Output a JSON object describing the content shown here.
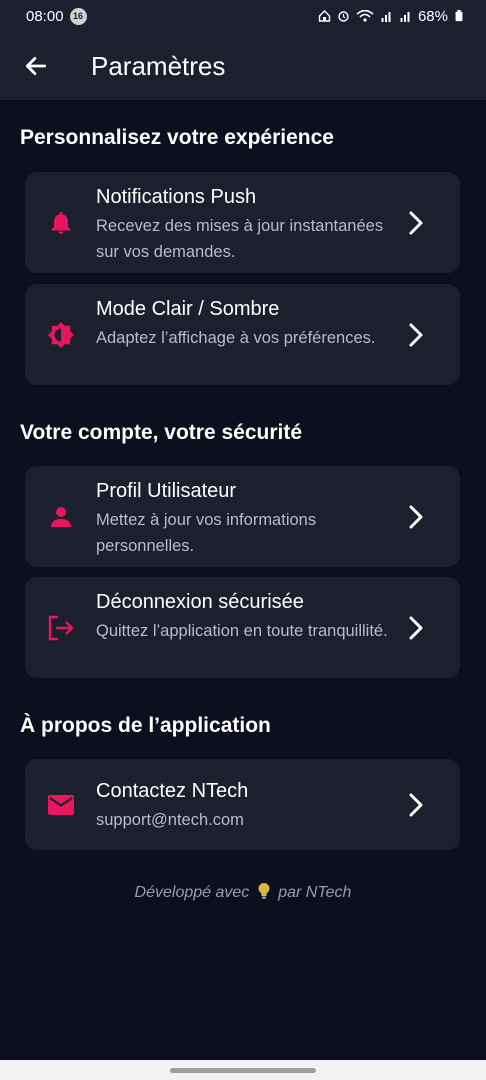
{
  "status_bar": {
    "time": "08:00",
    "notification_count": "16",
    "battery": "68%"
  },
  "app_bar": {
    "title": "Paramètres",
    "back_icon": "arrow-back-icon"
  },
  "sections": [
    {
      "title": "Personnalisez votre expérience",
      "items": [
        {
          "title": "Notifications Push",
          "subtitle": "Recevez des mises à jour instantanées sur vos demandes.",
          "icon": "bell-icon"
        },
        {
          "title": "Mode Clair / Sombre",
          "subtitle": "Adaptez l’affichage à vos préférences.",
          "icon": "brightness-icon"
        }
      ]
    },
    {
      "title": "Votre compte, votre sécurité",
      "items": [
        {
          "title": "Profil Utilisateur",
          "subtitle": "Mettez à jour vos informations personnelles.",
          "icon": "person-icon"
        },
        {
          "title": "Déconnexion sécurisée",
          "subtitle": "Quittez l’application en toute tranquillité.",
          "icon": "logout-icon"
        }
      ]
    },
    {
      "title": "À propos de l’application",
      "items": [
        {
          "title": "Contactez NTech",
          "subtitle": "support@ntech.com",
          "icon": "mail-icon"
        }
      ]
    }
  ],
  "footer": {
    "before": "Développé avec",
    "icon": "lightbulb-icon",
    "after": "par NTech"
  },
  "colors": {
    "background": "#0b0f1e",
    "card": "#1c1f2e",
    "accent": "#e8175d",
    "subtitle_text": "#b9bcc6"
  }
}
